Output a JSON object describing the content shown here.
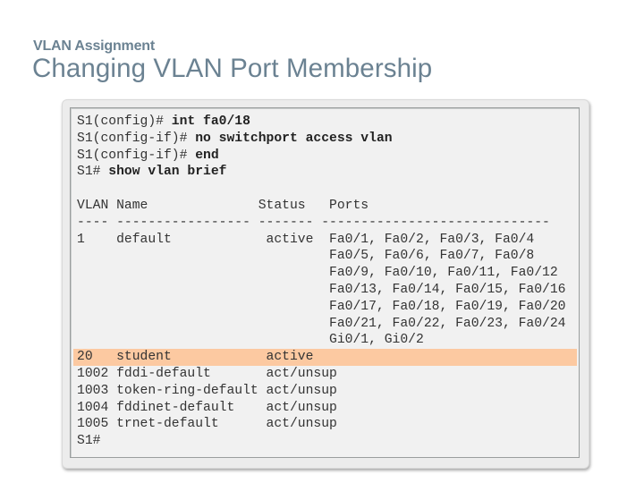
{
  "header": {
    "subtitle": "VLAN Assignment",
    "title": "Changing VLAN Port Membership"
  },
  "console": {
    "commands": [
      {
        "prompt": "S1(config)# ",
        "command": "int fa0/18"
      },
      {
        "prompt": "S1(config-if)# ",
        "command": "no switchport access vlan"
      },
      {
        "prompt": "S1(config-if)# ",
        "command": "end"
      },
      {
        "prompt": "S1# ",
        "command": "show vlan brief"
      }
    ],
    "table_header": "VLAN Name              Status   Ports",
    "table_separator": "---- ----------------- ------- -----------------------------",
    "rows": [
      "1    default            active  Fa0/1, Fa0/2, Fa0/3, Fa0/4",
      "                                Fa0/5, Fa0/6, Fa0/7, Fa0/8",
      "                                Fa0/9, Fa0/10, Fa0/11, Fa0/12",
      "                                Fa0/13, Fa0/14, Fa0/15, Fa0/16",
      "                                Fa0/17, Fa0/18, Fa0/19, Fa0/20",
      "                                Fa0/21, Fa0/22, Fa0/23, Fa0/24",
      "                                Gi0/1, Gi0/2"
    ],
    "highlighted_row": "20   student            active",
    "other_rows": [
      "1002 fddi-default       act/unsup",
      "1003 token-ring-default act/unsup",
      "1004 fddinet-default    act/unsup",
      "1005 trnet-default      act/unsup"
    ],
    "final_prompt": "S1#"
  },
  "colors": {
    "title": "#6b8292",
    "highlight": "#fcc9a1",
    "console_bg": "#f1f1f1"
  }
}
